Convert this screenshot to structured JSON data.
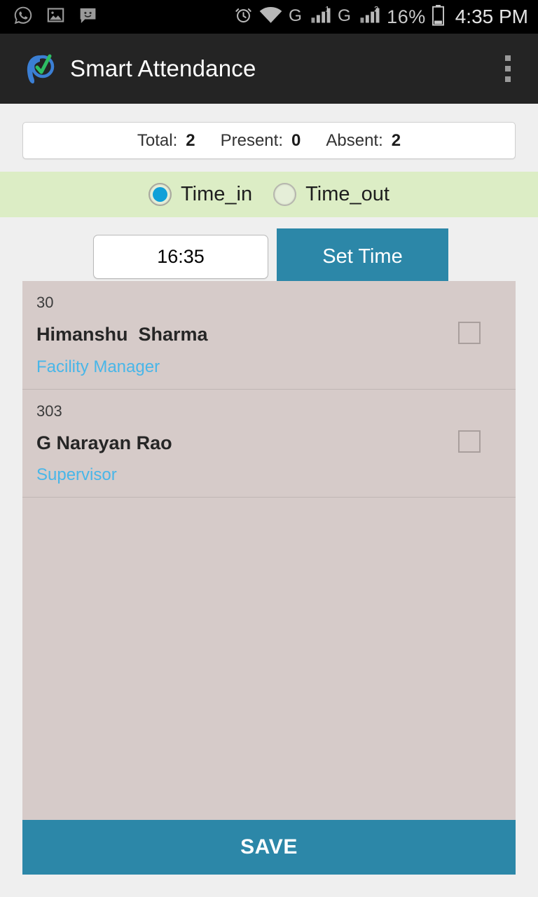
{
  "status_bar": {
    "left_icons": [
      "whatsapp-icon",
      "gallery-icon",
      "messaging-icon"
    ],
    "right_icons": [
      "alarm-icon",
      "wifi-icon",
      "gprs-sim1-icon",
      "signal-sim1-icon",
      "gprs-sim2-icon",
      "signal-sim2-icon",
      "battery-icon"
    ],
    "battery_percent": "16%",
    "clock": "4:35 PM"
  },
  "app_bar": {
    "title": "Smart Attendance",
    "logo": "smart-attendance-logo",
    "overflow": "overflow-menu-icon",
    "background": "#242424"
  },
  "summary": {
    "total_label": "Total:",
    "total_value": "2",
    "present_label": "Present:",
    "present_value": "0",
    "absent_label": "Absent:",
    "absent_value": "2"
  },
  "mode": {
    "background": "#dcedc5",
    "options": [
      {
        "label": "Time_in",
        "selected": true
      },
      {
        "label": "Time_out",
        "selected": false
      }
    ]
  },
  "time_row": {
    "time_value": "16:35",
    "time_placeholder": "HH:MM",
    "set_time_label": "Set Time",
    "accent": "#2c87a8"
  },
  "employees": [
    {
      "id": "30",
      "name": "Himanshu  Sharma",
      "role": "Facility Manager",
      "checked": false
    },
    {
      "id": "303",
      "name": "G Narayan Rao",
      "role": "Supervisor",
      "checked": false
    }
  ],
  "list": {
    "background": "#d6cbc9",
    "role_color": "#49b6e8"
  },
  "save": {
    "label": "SAVE",
    "background": "#2c87a8"
  }
}
